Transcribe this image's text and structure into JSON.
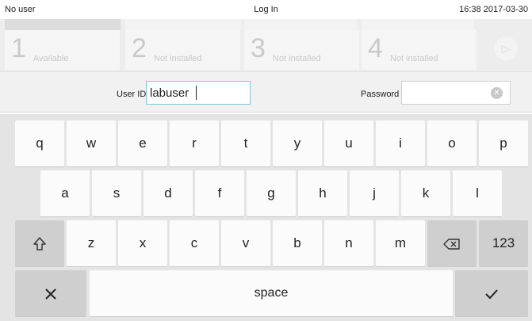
{
  "status_bar": {
    "user": "No user",
    "title": "Log In",
    "datetime": "16:38 2017-03-30"
  },
  "bays": [
    {
      "number": "1",
      "label": "Available"
    },
    {
      "number": "2",
      "label": "Not installed"
    },
    {
      "number": "3",
      "label": "Not installed"
    },
    {
      "number": "4",
      "label": "Not installed"
    }
  ],
  "login": {
    "user_id_label": "User ID",
    "user_id_value": "labuser",
    "password_label": "Password",
    "password_value": ""
  },
  "keyboard": {
    "row1": [
      "q",
      "w",
      "e",
      "r",
      "t",
      "y",
      "u",
      "i",
      "o",
      "p"
    ],
    "row2": [
      "a",
      "s",
      "d",
      "f",
      "g",
      "h",
      "j",
      "k",
      "l"
    ],
    "row3": [
      "z",
      "x",
      "c",
      "v",
      "b",
      "n",
      "m"
    ],
    "numbers_label": "123",
    "space_label": "space"
  },
  "icons": [
    "shift-icon",
    "backspace-icon",
    "close-icon",
    "check-icon",
    "clear-icon",
    "next-icon"
  ]
}
